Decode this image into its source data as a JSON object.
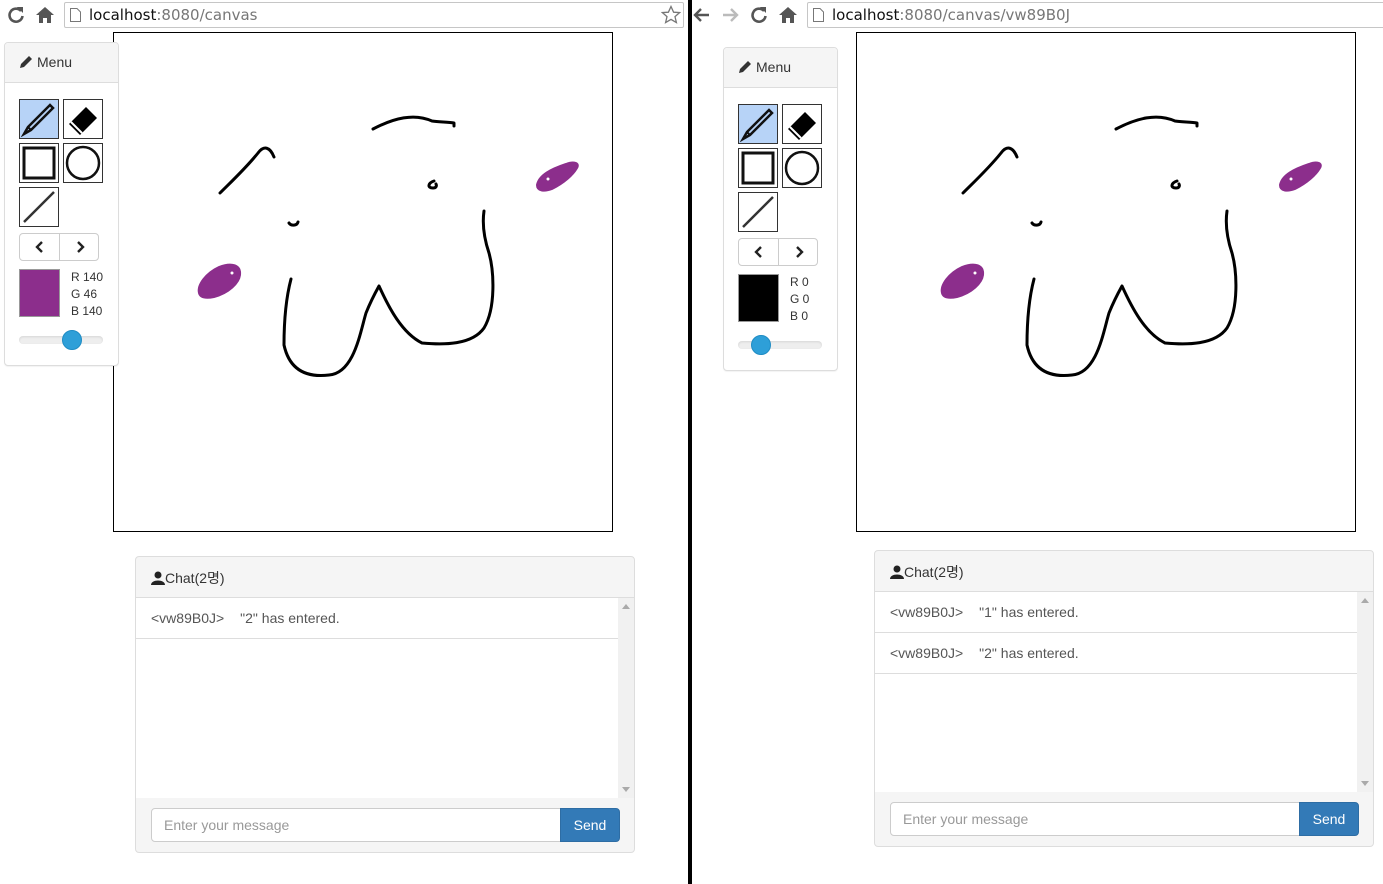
{
  "left": {
    "url_host": "localhost",
    "url_rest": ":8080/canvas",
    "menu": {
      "title": "Menu",
      "color_hex": "#8c2e8c",
      "rgb": {
        "r": "R 140",
        "g": "G 46",
        "b": "B 140"
      },
      "brush_size_fraction": 0.67
    },
    "chat": {
      "title": "Chat(2명)",
      "messages": [
        {
          "sender": "<vw89B0J>",
          "text": "\"2\" has entered."
        }
      ],
      "input_placeholder": "Enter your message",
      "send_label": "Send"
    }
  },
  "right": {
    "url_host": "localhost",
    "url_rest": ":8080/canvas/vw89B0J",
    "menu": {
      "title": "Menu",
      "color_hex": "#000000",
      "rgb": {
        "r": "R 0",
        "g": "G 0",
        "b": "B 0"
      },
      "brush_size_fraction": 0.2
    },
    "chat": {
      "title": "Chat(2명)",
      "messages": [
        {
          "sender": "<vw89B0J>",
          "text": "\"1\" has entered."
        },
        {
          "sender": "<vw89B0J>",
          "text": "\"2\" has entered."
        }
      ],
      "input_placeholder": "Enter your message",
      "send_label": "Send"
    }
  },
  "colors": {
    "accent": "#337ab7",
    "active_tool": "#b7d3f7",
    "stroke_purple": "#8c2e8c",
    "stroke_black": "#000000"
  },
  "icons": [
    "reload-icon",
    "home-icon",
    "back-icon",
    "forward-icon",
    "page-icon",
    "star-icon",
    "pencil-icon",
    "eraser-icon",
    "rectangle-icon",
    "circle-icon",
    "line-icon",
    "chevron-left-icon",
    "chevron-right-icon",
    "user-icon"
  ]
}
